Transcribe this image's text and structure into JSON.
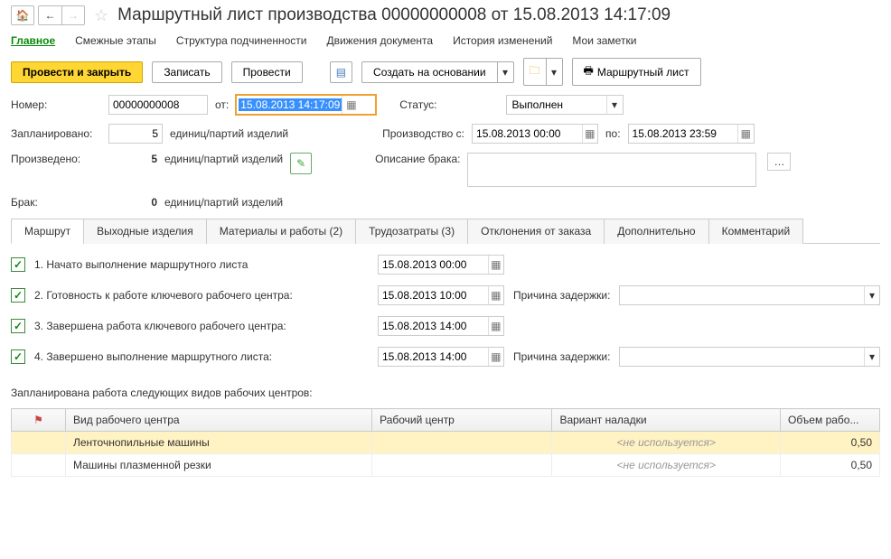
{
  "header": {
    "title": "Маршрутный лист производства 00000000008 от 15.08.2013 14:17:09"
  },
  "nav": {
    "main": "Главное",
    "stages": "Смежные этапы",
    "structure": "Структура подчиненности",
    "movements": "Движения документа",
    "history": "История изменений",
    "notes": "Мои заметки"
  },
  "toolbar": {
    "post_close": "Провести и закрыть",
    "write": "Записать",
    "post": "Провести",
    "create_based": "Создать на основании",
    "route_sheet": "Маршрутный лист"
  },
  "fields": {
    "number_lbl": "Номер:",
    "number_val": "00000000008",
    "from_lbl": "от:",
    "from_val": "15.08.2013 14:17:09",
    "status_lbl": "Статус:",
    "status_val": "Выполнен",
    "planned_lbl": "Запланировано:",
    "planned_val": "5",
    "units": "единиц/партий изделий",
    "prod_from_lbl": "Производство с:",
    "prod_from_val": "15.08.2013 00:00",
    "to_lbl": "по:",
    "prod_to_val": "15.08.2013 23:59",
    "produced_lbl": "Произведено:",
    "produced_val": "5",
    "defect_desc_lbl": "Описание брака:",
    "defect_lbl": "Брак:",
    "defect_val": "0"
  },
  "tabs": {
    "route": "Маршрут",
    "output": "Выходные изделия",
    "materials": "Материалы и работы (2)",
    "labor": "Трудозатраты (3)",
    "deviations": "Отклонения от заказа",
    "additional": "Дополнительно",
    "comment": "Комментарий"
  },
  "stages": [
    {
      "label": "1. Начато выполнение маршрутного листа",
      "date": "15.08.2013 00:00",
      "reason": false
    },
    {
      "label": "2. Готовность к работе ключевого рабочего центра:",
      "date": "15.08.2013 10:00",
      "reason": true
    },
    {
      "label": "3. Завершена работа ключевого рабочего центра:",
      "date": "15.08.2013 14:00",
      "reason": false
    },
    {
      "label": "4. Завершено выполнение маршрутного листа:",
      "date": "15.08.2013 14:00",
      "reason": true
    }
  ],
  "reason_lbl": "Причина задержки:",
  "work_section": "Запланирована работа следующих видов рабочих центров:",
  "grid": {
    "cols": {
      "c1": "",
      "c2": "Вид рабочего центра",
      "c3": "Рабочий центр",
      "c4": "Вариант наладки",
      "c5": "Объем рабо..."
    },
    "rows": [
      {
        "type": "Ленточнопильные машины",
        "center": "",
        "setup": "<не используется>",
        "vol": "0,50",
        "sel": true
      },
      {
        "type": "Машины плазменной резки",
        "center": "",
        "setup": "<не используется>",
        "vol": "0,50",
        "sel": false
      }
    ]
  }
}
